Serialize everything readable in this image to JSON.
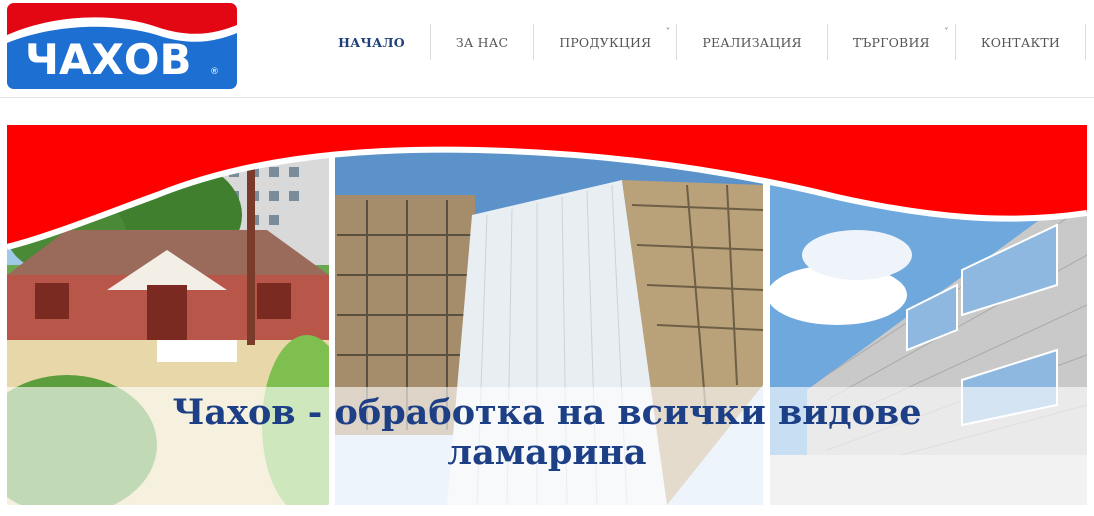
{
  "brand": {
    "logo_text": "ЧАХОВ",
    "registered_mark": "®",
    "colors": {
      "red": "#e30613",
      "blue": "#1d6fd1"
    }
  },
  "nav": {
    "items": [
      {
        "label": "НАЧАЛО",
        "active": true
      },
      {
        "label": "ЗА НАС"
      },
      {
        "label": "ПРОДУКЦИЯ",
        "caret": "˅"
      },
      {
        "label": "РЕАЛИЗАЦИЯ"
      },
      {
        "label": "ТЪРГОВИЯ",
        "caret": "˅"
      },
      {
        "label": "КОНТАКТИ"
      }
    ]
  },
  "hero": {
    "title_line1": "Чахов - обработка на всички видове",
    "title_line2": "ламарина"
  }
}
